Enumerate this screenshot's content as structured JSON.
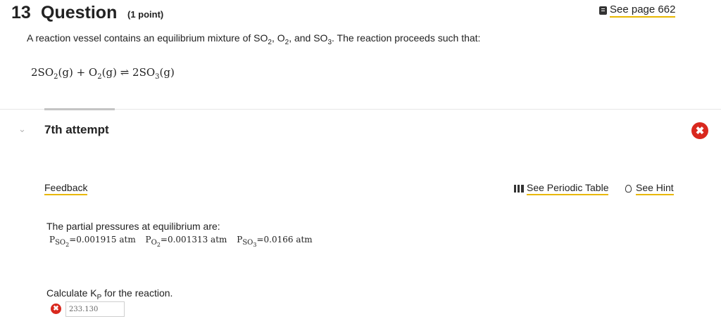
{
  "question": {
    "number": "13",
    "word": "Question",
    "points": "(1 point)",
    "see_page": "See page 662",
    "intro_part1": "A reaction vessel contains an equilibrium mixture of SO",
    "intro_sub1": "2",
    "intro_part2": ", O",
    "intro_sub2": "2",
    "intro_part3": ", and SO",
    "intro_sub3": "3",
    "intro_part4": ". The reaction proceeds such that:",
    "equation": {
      "left1": "2SO",
      "left1_sub": "2",
      "left1_state": "(g)",
      "plus": " + ",
      "left2": "O",
      "left2_sub": "2",
      "left2_state": "(g)",
      "arrow": " ⇌ ",
      "right": "2SO",
      "right_sub": "3",
      "right_state": "(g)"
    }
  },
  "attempt": {
    "label": "7th attempt",
    "chevron": "⌄",
    "status_mark": "✖"
  },
  "links": {
    "feedback": "Feedback",
    "periodic_table": "See Periodic Table",
    "hint": "See Hint"
  },
  "pressures": {
    "title": "The partial pressures at equilibrium are:",
    "items": [
      {
        "symbol": "P",
        "sub": "SO",
        "subsub": "2",
        "value": "=0.001915 atm"
      },
      {
        "symbol": "P",
        "sub": "O",
        "subsub": "2",
        "value": "=0.001313 atm"
      },
      {
        "symbol": "P",
        "sub": "SO",
        "subsub": "3",
        "value": "=0.0166 atm"
      }
    ]
  },
  "calculate": {
    "text_before": "Calculate K",
    "text_sub": "P",
    "text_after": " for the reaction.",
    "answer_value": "233.130",
    "answer_mark": "✖"
  },
  "icons": {
    "book": "book-icon",
    "periodic": "periodic-table-icon",
    "hint": "lightbulb-icon",
    "wrong": "x-circle-icon"
  },
  "colors": {
    "link_underline": "#e8b700",
    "error_red": "#d9281e"
  }
}
